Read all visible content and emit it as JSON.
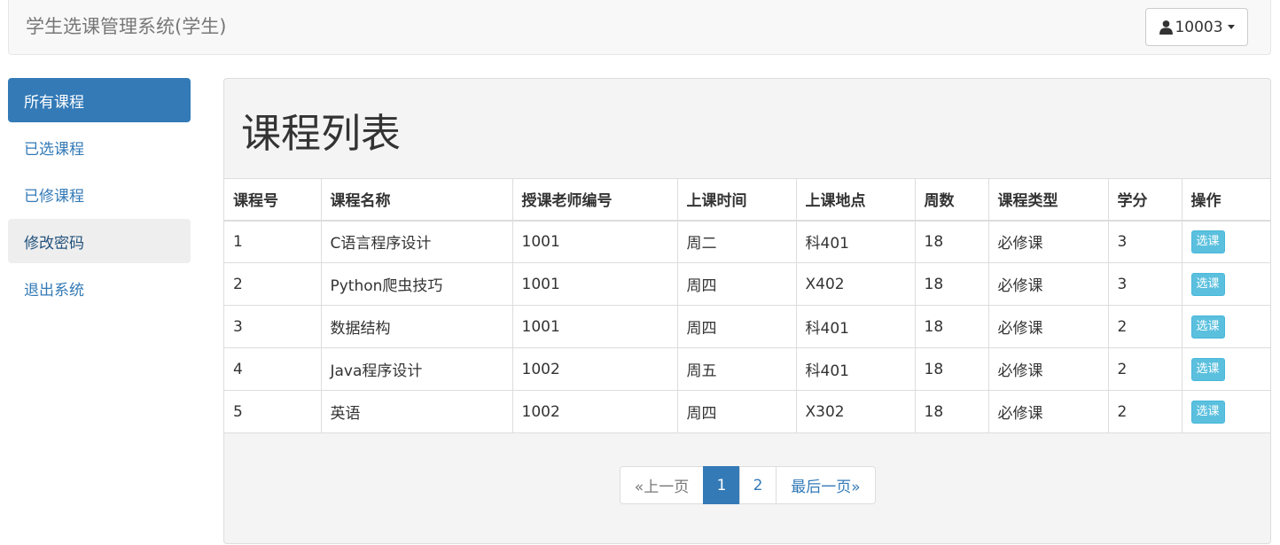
{
  "header": {
    "brand": "学生选课管理系统(学生)",
    "user": {
      "icon": "user-icon",
      "label": "10003"
    }
  },
  "sidebar": {
    "items": [
      {
        "label": "所有课程",
        "state": "active"
      },
      {
        "label": "已选课程",
        "state": "normal"
      },
      {
        "label": "已修课程",
        "state": "normal"
      },
      {
        "label": "修改密码",
        "state": "hover"
      },
      {
        "label": "退出系统",
        "state": "normal"
      }
    ]
  },
  "main": {
    "title": "课程列表",
    "table": {
      "headers": [
        "课程号",
        "课程名称",
        "授课老师编号",
        "上课时间",
        "上课地点",
        "周数",
        "课程类型",
        "学分",
        "操作"
      ],
      "rows": [
        [
          "1",
          "C语言程序设计",
          "1001",
          "周二",
          "科401",
          "18",
          "必修课",
          "3",
          "选课"
        ],
        [
          "2",
          "Python爬虫技巧",
          "1001",
          "周四",
          "X402",
          "18",
          "必修课",
          "3",
          "选课"
        ],
        [
          "3",
          "数据结构",
          "1001",
          "周四",
          "科401",
          "18",
          "必修课",
          "2",
          "选课"
        ],
        [
          "4",
          "Java程序设计",
          "1002",
          "周五",
          "科401",
          "18",
          "必修课",
          "2",
          "选课"
        ],
        [
          "5",
          "英语",
          "1002",
          "周四",
          "X302",
          "18",
          "必修课",
          "2",
          "选课"
        ]
      ]
    },
    "pagination": {
      "prev": "«上一页",
      "pages": [
        "1",
        "2"
      ],
      "current": "1",
      "last": "最后一页»"
    }
  },
  "colors": {
    "primary": "#337ab7",
    "info_button": "#5bc0de",
    "panel_bg": "#f4f4f4",
    "navbar_bg": "#f8f8f8"
  }
}
